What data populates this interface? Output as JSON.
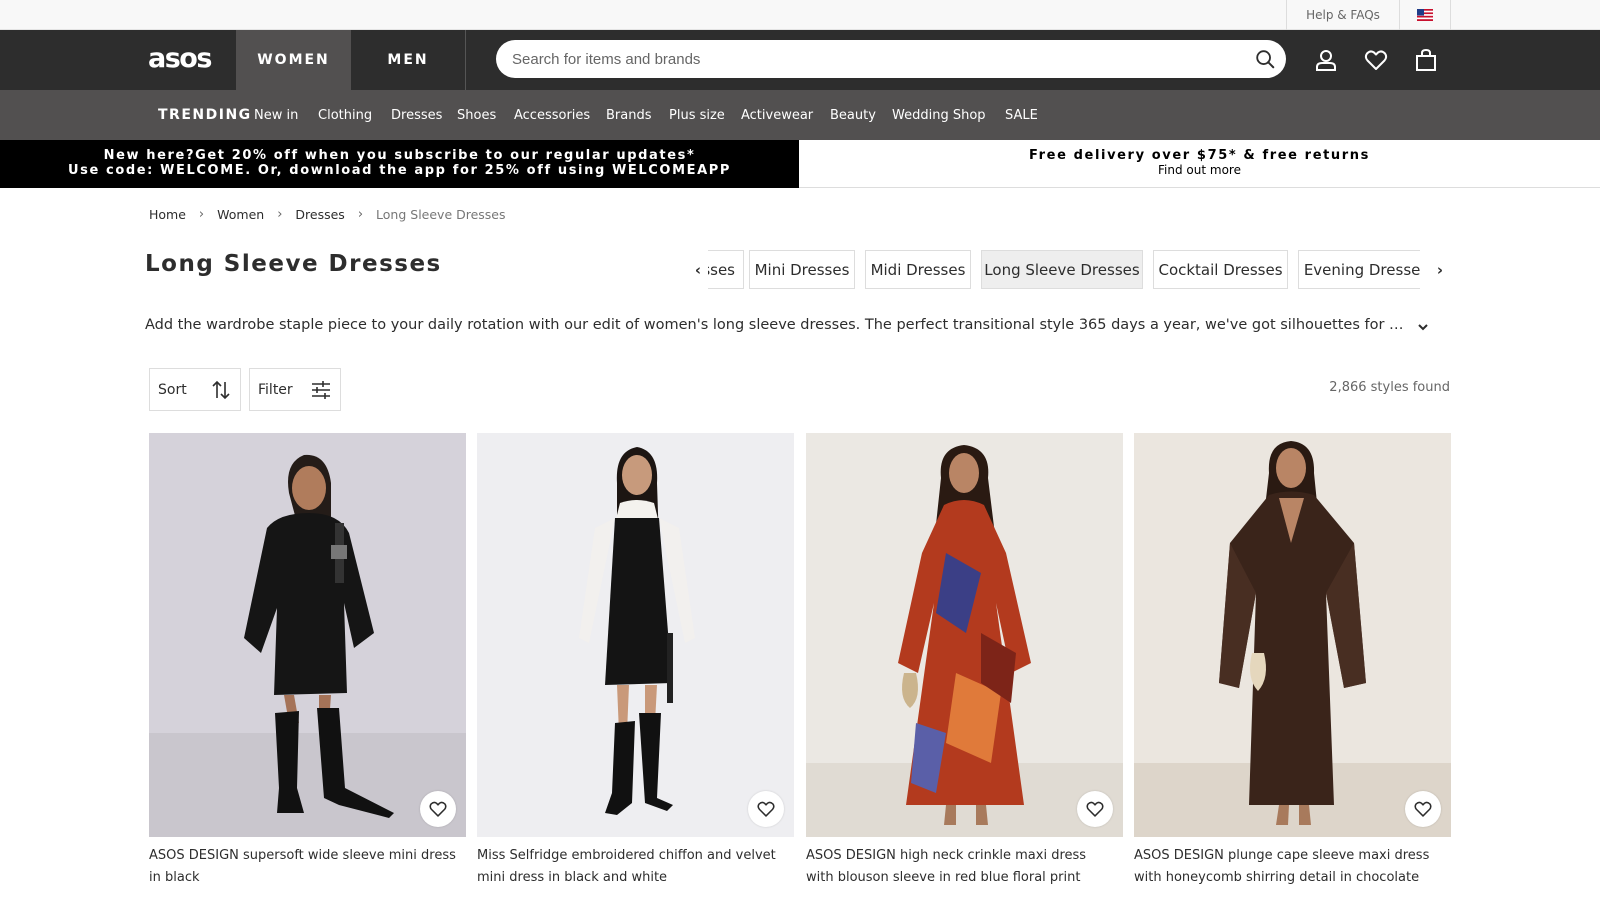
{
  "utility": {
    "help_label": "Help & FAQs",
    "flag_icon": "us-flag-icon"
  },
  "header": {
    "logo": "asos",
    "tabs": [
      "WOMEN",
      "MEN"
    ],
    "search_placeholder": "Search for items and brands",
    "icons": [
      "search-icon",
      "account-icon",
      "saved-items-icon",
      "bag-icon"
    ]
  },
  "nav": {
    "items": [
      "TRENDING",
      "New in",
      "Clothing",
      "Dresses",
      "Shoes",
      "Accessories",
      "Brands",
      "Plus size",
      "Activewear",
      "Beauty",
      "Wedding Shop",
      "SALE"
    ]
  },
  "promo": {
    "left_line1": "New here?Get 20% off when you subscribe to our regular updates*",
    "left_line2": "Use code: WELCOME. Or, download the app for 25% off using WELCOMEAPP",
    "right_title": "Free delivery over $75* & free returns",
    "right_link": "Find out more"
  },
  "breadcrumb": {
    "items": [
      "Home",
      "Women",
      "Dresses",
      "Long Sleeve Dresses"
    ],
    "separator": "›"
  },
  "page": {
    "title": "Long Sleeve Dresses",
    "description": "Add the wardrobe staple piece to your daily rotation with our edit of women's long sleeve dresses. The perfect transitional style 365 days a year, we've got silhouettes for every aesthetic — fr...",
    "styles_found": "2,866 styles found"
  },
  "categories": {
    "pills": [
      "sses",
      "Mini Dresses",
      "Midi Dresses",
      "Long Sleeve Dresses",
      "Cocktail Dresses",
      "Evening Dresses"
    ],
    "active": "Long Sleeve Dresses",
    "prev_glyph": "‹",
    "next_glyph": "›"
  },
  "controls": {
    "sort_label": "Sort",
    "filter_label": "Filter"
  },
  "products": [
    {
      "name": "ASOS DESIGN supersoft wide sleeve mini dress in black",
      "price": "",
      "image": "woman-in-black-mini-dress-and-knee-boots",
      "bg": "#d3d0d8"
    },
    {
      "name": "Miss Selfridge embroidered chiffon and velvet mini dress in black and white",
      "price": "",
      "image": "woman-in-black-velvet-mini-dress-white-sleeves",
      "bg": "#eeeef0"
    },
    {
      "name": "ASOS DESIGN high neck crinkle maxi dress with blouson sleeve in red blue floral print",
      "price": "",
      "image": "woman-in-red-blue-print-maxi-dress",
      "bg": "#e9e6e1"
    },
    {
      "name": "ASOS DESIGN plunge cape sleeve maxi dress with honeycomb shirring detail in chocolate",
      "price": "",
      "image": "woman-in-chocolate-chiffon-maxi-dress",
      "bg": "#e8e3dc"
    }
  ],
  "colors": {
    "header_bg": "#2d2d2d",
    "nav_bg": "#525050",
    "promo_bg": "#000000"
  }
}
